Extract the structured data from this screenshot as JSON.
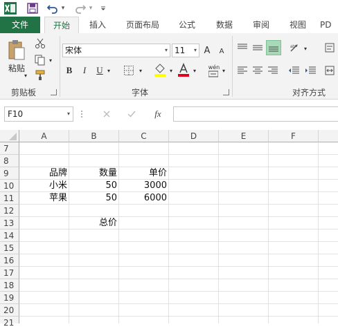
{
  "qat": {
    "dropdown_symbol": "▾"
  },
  "tabs": [
    "文件",
    "开始",
    "插入",
    "页面布局",
    "公式",
    "数据",
    "审阅",
    "视图",
    "PD"
  ],
  "ribbon": {
    "clipboard": {
      "paste_label": "粘贴",
      "group_label": "剪贴板"
    },
    "font": {
      "font_name": "宋体",
      "font_size": "11",
      "bold": "B",
      "italic": "I",
      "underline": "U",
      "grow": "A",
      "shrink": "A",
      "phonetic": "wén",
      "group_label": "字体"
    },
    "alignment": {
      "group_label": "对齐方式"
    }
  },
  "formula_bar": {
    "name_box": "F10",
    "fx": "fx",
    "value": ""
  },
  "grid": {
    "columns": [
      "A",
      "B",
      "C",
      "D",
      "E",
      "F"
    ],
    "rows": [
      "7",
      "8",
      "9",
      "10",
      "11",
      "12",
      "13",
      "14",
      "15",
      "16",
      "17",
      "18",
      "19",
      "20",
      "21"
    ]
  },
  "cells": {
    "A9": "品牌",
    "B9": "数量",
    "C9": "单价",
    "A10": "小米",
    "B10": "50",
    "C10": "3000",
    "A11": "苹果",
    "B11": "50",
    "C11": "6000",
    "B13": "总价"
  },
  "colors": {
    "excel_green": "#217346",
    "ribbon_bg": "#f3f3f3",
    "highlight_yellow": "#ffff00",
    "font_red": "#e0001b"
  }
}
